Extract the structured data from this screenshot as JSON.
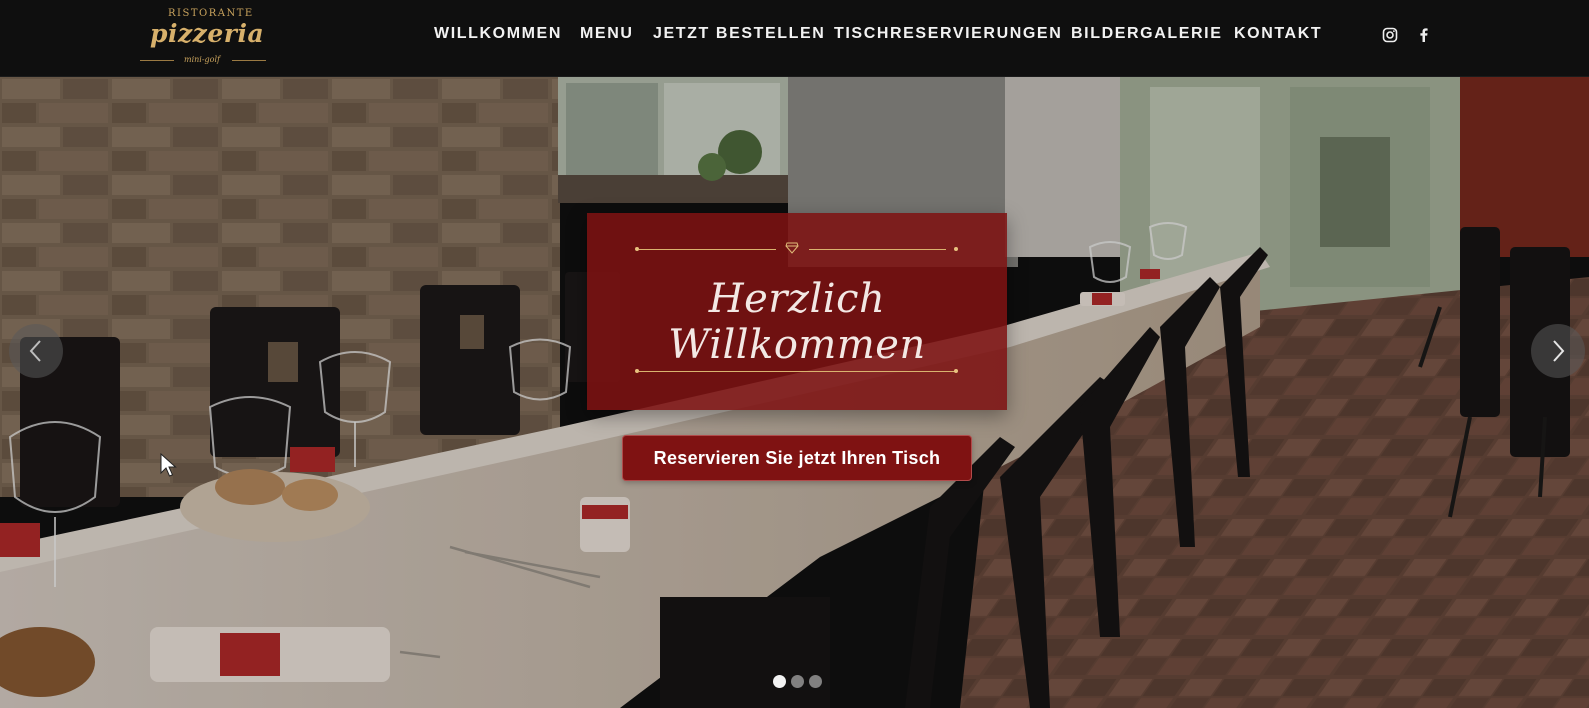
{
  "header": {
    "logo": {
      "top_text": "RISTORANTE",
      "main_text": "pizzeria",
      "sub_text": "mini-golf"
    },
    "nav": [
      {
        "label": "WILLKOMMEN"
      },
      {
        "label": "MENU"
      },
      {
        "label": "JETZT BESTELLEN"
      },
      {
        "label": "TISCHRESERVIERUNGEN"
      },
      {
        "label": "BILDERGALERIE"
      },
      {
        "label": "KONTAKT"
      }
    ],
    "social": [
      {
        "icon": "instagram-icon"
      },
      {
        "icon": "facebook-icon"
      }
    ]
  },
  "hero": {
    "title": "Herzlich Willkommen",
    "button_label": "Reservieren Sie jetzt Ihren Tisch",
    "slides": {
      "count": 3,
      "active": 1
    }
  },
  "colors": {
    "header_bg": "#0f0f0f",
    "accent_red": "#7f1212",
    "gold": "#d7b06b"
  }
}
